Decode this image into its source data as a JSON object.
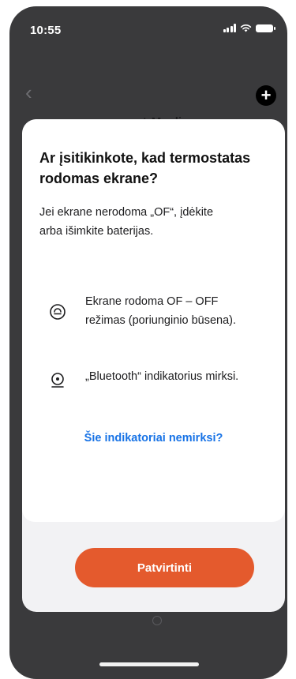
{
  "status_bar": {
    "time": "10:55"
  },
  "background_screen": {
    "title": "apqeotrMoclio"
  },
  "dialog": {
    "title": "Ar įsitikinkote, kad termostatas rodomas ekrane?",
    "body": "Jei ekrane nerodoma „OF“, įdėkite arba išimkite baterijas.",
    "indicators": [
      {
        "icon": "display-off-icon",
        "text": "Ekrane rodoma OF – OFF režimas (poriunginio būsena)."
      },
      {
        "icon": "bluetooth-blink-icon",
        "text": "„Bluetooth“ indikatorius mirksi."
      }
    ],
    "help_link": "Šie indikatoriai nemirksi?",
    "confirm_label": "Patvirtinti"
  },
  "colors": {
    "accent": "#e45a2d",
    "link": "#1672e6",
    "backdrop": "#3a3a3c"
  }
}
